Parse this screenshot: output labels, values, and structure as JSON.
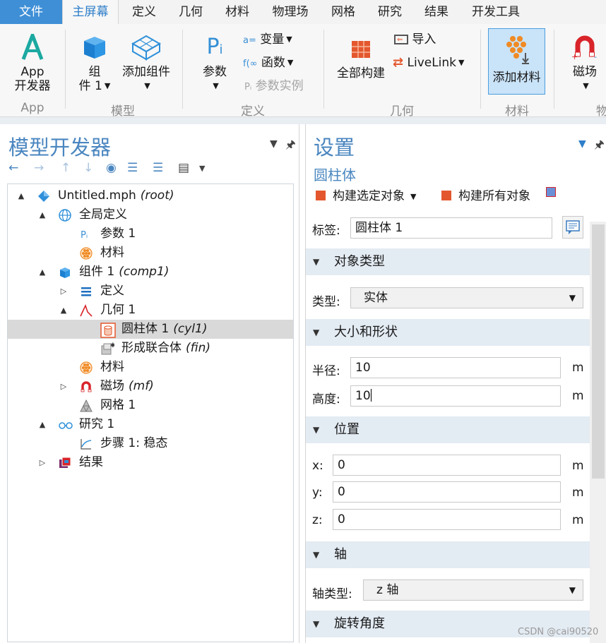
{
  "menubar": {
    "file": "文件",
    "items": [
      "主屏幕",
      "定义",
      "几何",
      "材料",
      "物理场",
      "网格",
      "研究",
      "结果",
      "开发工具"
    ]
  },
  "ribbon": {
    "app_builder": "App\n开发器",
    "app_builder_l1": "App",
    "app_builder_l2": "开发器",
    "component": "组",
    "component2": "件 1",
    "add_component": "添加组件",
    "parameters": "参数",
    "variables": "变量",
    "functions": "函数",
    "param_cases": "参数实例",
    "build_all": "全部构建",
    "import": "导入",
    "livelink": "LiveLink",
    "add_material": "添加材料",
    "magnetic": "磁场",
    "groups": [
      "App",
      "模型",
      "定义",
      "几何",
      "材料",
      "物"
    ]
  },
  "left_panel": {
    "title": "模型开发器",
    "tree": [
      {
        "label": "Untitled.mph",
        "tag": "(root)",
        "icon": "root-icon",
        "toggle": "▲"
      },
      {
        "label": "全局定义",
        "tag": "",
        "icon": "globe-icon",
        "toggle": "▲"
      },
      {
        "label": "参数 1",
        "tag": "",
        "icon": "parameter-icon",
        "toggle": ""
      },
      {
        "label": "材料",
        "tag": "",
        "icon": "materials-icon",
        "toggle": ""
      },
      {
        "label": "组件 1",
        "tag": "(comp1)",
        "icon": "component-icon",
        "toggle": "▲"
      },
      {
        "label": "定义",
        "tag": "",
        "icon": "definitions-icon",
        "toggle": "▷"
      },
      {
        "label": "几何 1",
        "tag": "",
        "icon": "geometry-icon",
        "toggle": "▲"
      },
      {
        "label": "圆柱体 1",
        "tag": "(cyl1)",
        "icon": "cylinder-icon",
        "toggle": ""
      },
      {
        "label": "形成联合体",
        "tag": "(fin)",
        "icon": "form-union-icon",
        "toggle": ""
      },
      {
        "label": "材料",
        "tag": "",
        "icon": "materials-icon",
        "toggle": ""
      },
      {
        "label": "磁场",
        "tag": "(mf)",
        "icon": "magnet-icon",
        "toggle": "▷"
      },
      {
        "label": "网格 1",
        "tag": "",
        "icon": "mesh-icon",
        "toggle": ""
      },
      {
        "label": "研究 1",
        "tag": "",
        "icon": "study-icon",
        "toggle": "▲"
      },
      {
        "label": "步骤 1: 稳态",
        "tag": "",
        "icon": "step-icon",
        "toggle": ""
      },
      {
        "label": "结果",
        "tag": "",
        "icon": "results-icon",
        "toggle": "▷"
      }
    ]
  },
  "right_panel": {
    "title": "设置",
    "subtitle": "圆柱体",
    "build_selected": "构建选定对象",
    "build_all_objects": "构建所有对象",
    "label_caption": "标签:",
    "label_value": "圆柱体 1",
    "sections": {
      "object_type": "对象类型",
      "size_shape": "大小和形状",
      "position": "位置",
      "axis": "轴",
      "rotation": "旋转角度"
    },
    "type_caption": "类型:",
    "type_value": "实体",
    "radius_caption": "半径:",
    "radius_value": "10",
    "height_caption": "高度:",
    "height_value": "10",
    "unit": "m",
    "x_caption": "x:",
    "x_value": "0",
    "y_caption": "y:",
    "y_value": "0",
    "z_caption": "z:",
    "z_value": "0",
    "axis_type_caption": "轴类型:",
    "axis_type_value": "z 轴"
  },
  "watermark": "CSDN @cai90520",
  "colors": {
    "accent": "#2f7fc9",
    "title_blue": "#4a86c0",
    "file_tab": "#3e8fd6",
    "selected_row": "#d9d9d9"
  }
}
